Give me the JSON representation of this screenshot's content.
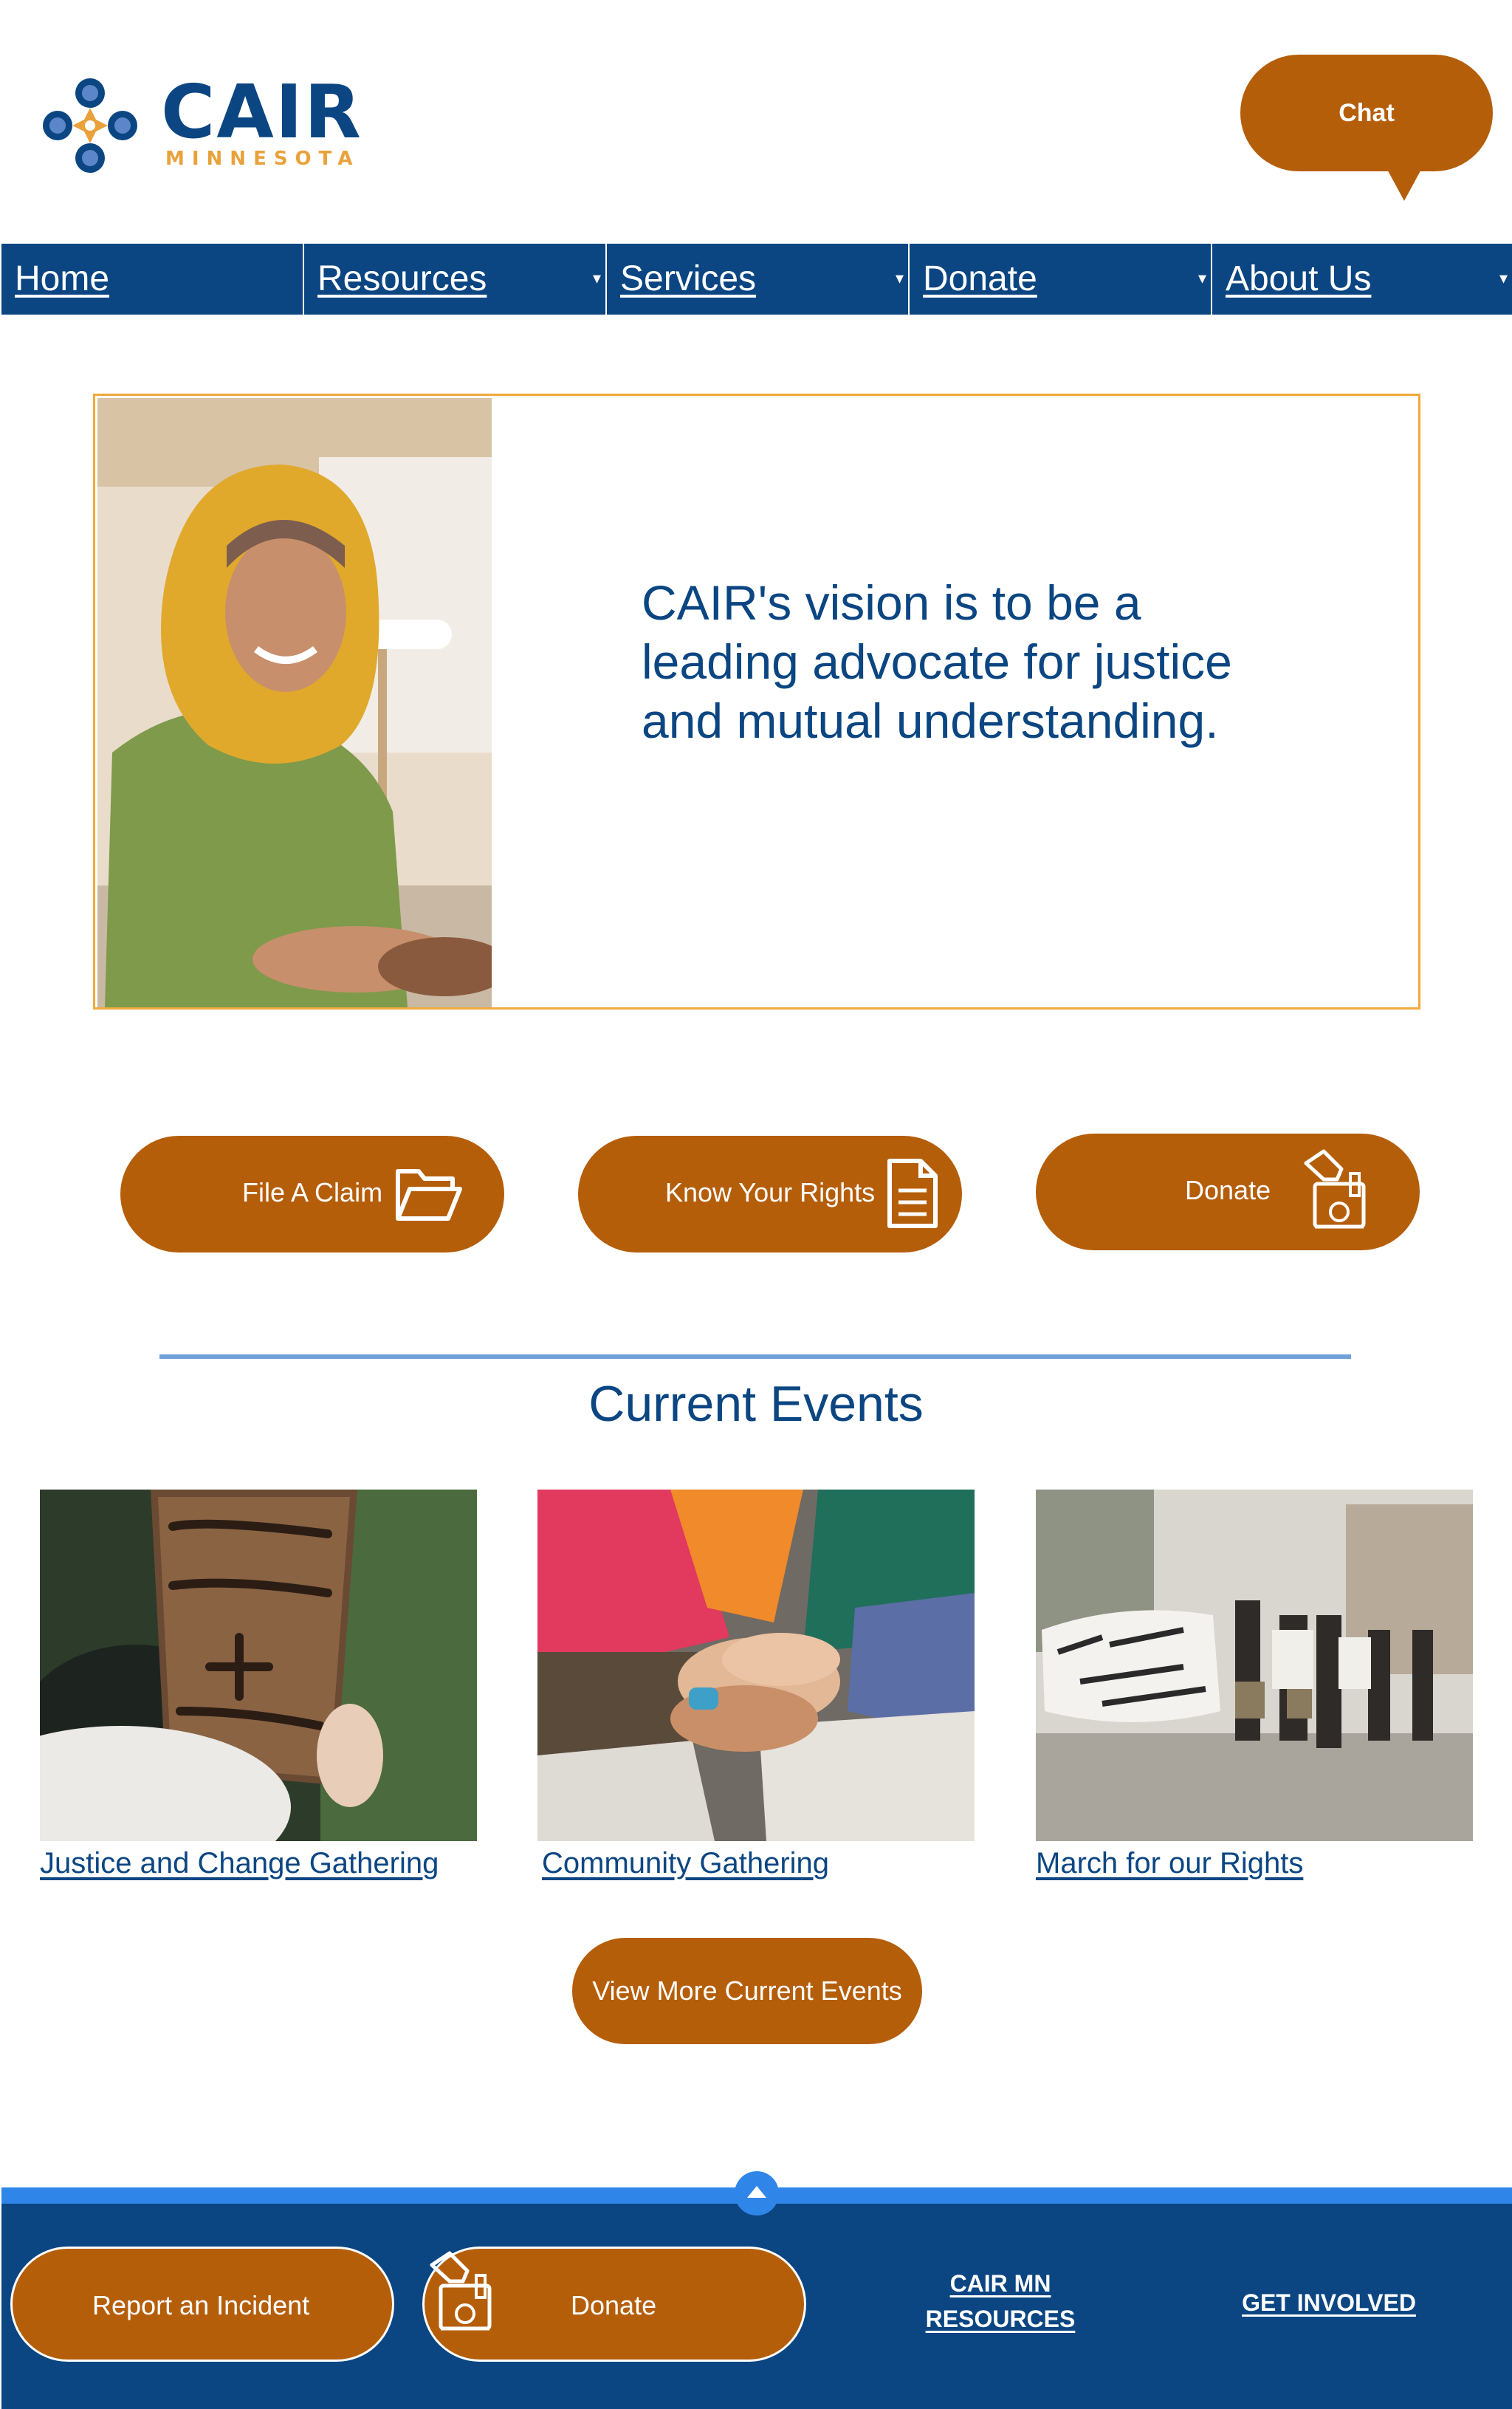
{
  "header": {
    "logo_word": "CAIR",
    "logo_sub": "MINNESOTA",
    "chat_label": "Chat"
  },
  "nav": {
    "items": [
      {
        "label": "Home",
        "dropdown": false
      },
      {
        "label": "Resources",
        "dropdown": true
      },
      {
        "label": "Services",
        "dropdown": true
      },
      {
        "label": "Donate",
        "dropdown": true
      },
      {
        "label": "About Us",
        "dropdown": true
      }
    ],
    "caret": "▾"
  },
  "hero": {
    "text": "CAIR's vision is to be a leading advocate for justice and mutual understanding."
  },
  "actions": {
    "file_claim": {
      "label": "File A Claim",
      "icon": "folder-open-icon"
    },
    "know_rights": {
      "label": "Know Your Rights",
      "icon": "document-icon"
    },
    "donate": {
      "label": "Donate",
      "icon": "donation-box-icon"
    }
  },
  "events": {
    "title": "Current Events",
    "items": [
      {
        "label": "Justice and Change Gathering",
        "image": "protest-sign-photo"
      },
      {
        "label": "Community Gathering",
        "image": "stacked-hands-photo"
      },
      {
        "label": "March for our Rights",
        "image": "march-crowd-photo"
      }
    ],
    "more_label": "View More Current Events"
  },
  "footer": {
    "report_label": "Report an Incident",
    "donate_label": "Donate",
    "resources_line1": "CAIR MN",
    "resources_line2": "RESOURCES",
    "get_involved": "GET INVOLVED"
  },
  "colors": {
    "navy": "#0b4682",
    "orange_button": "#b55e0a",
    "gold_border": "#f0a93b",
    "accent_blue": "#2f86e8"
  }
}
